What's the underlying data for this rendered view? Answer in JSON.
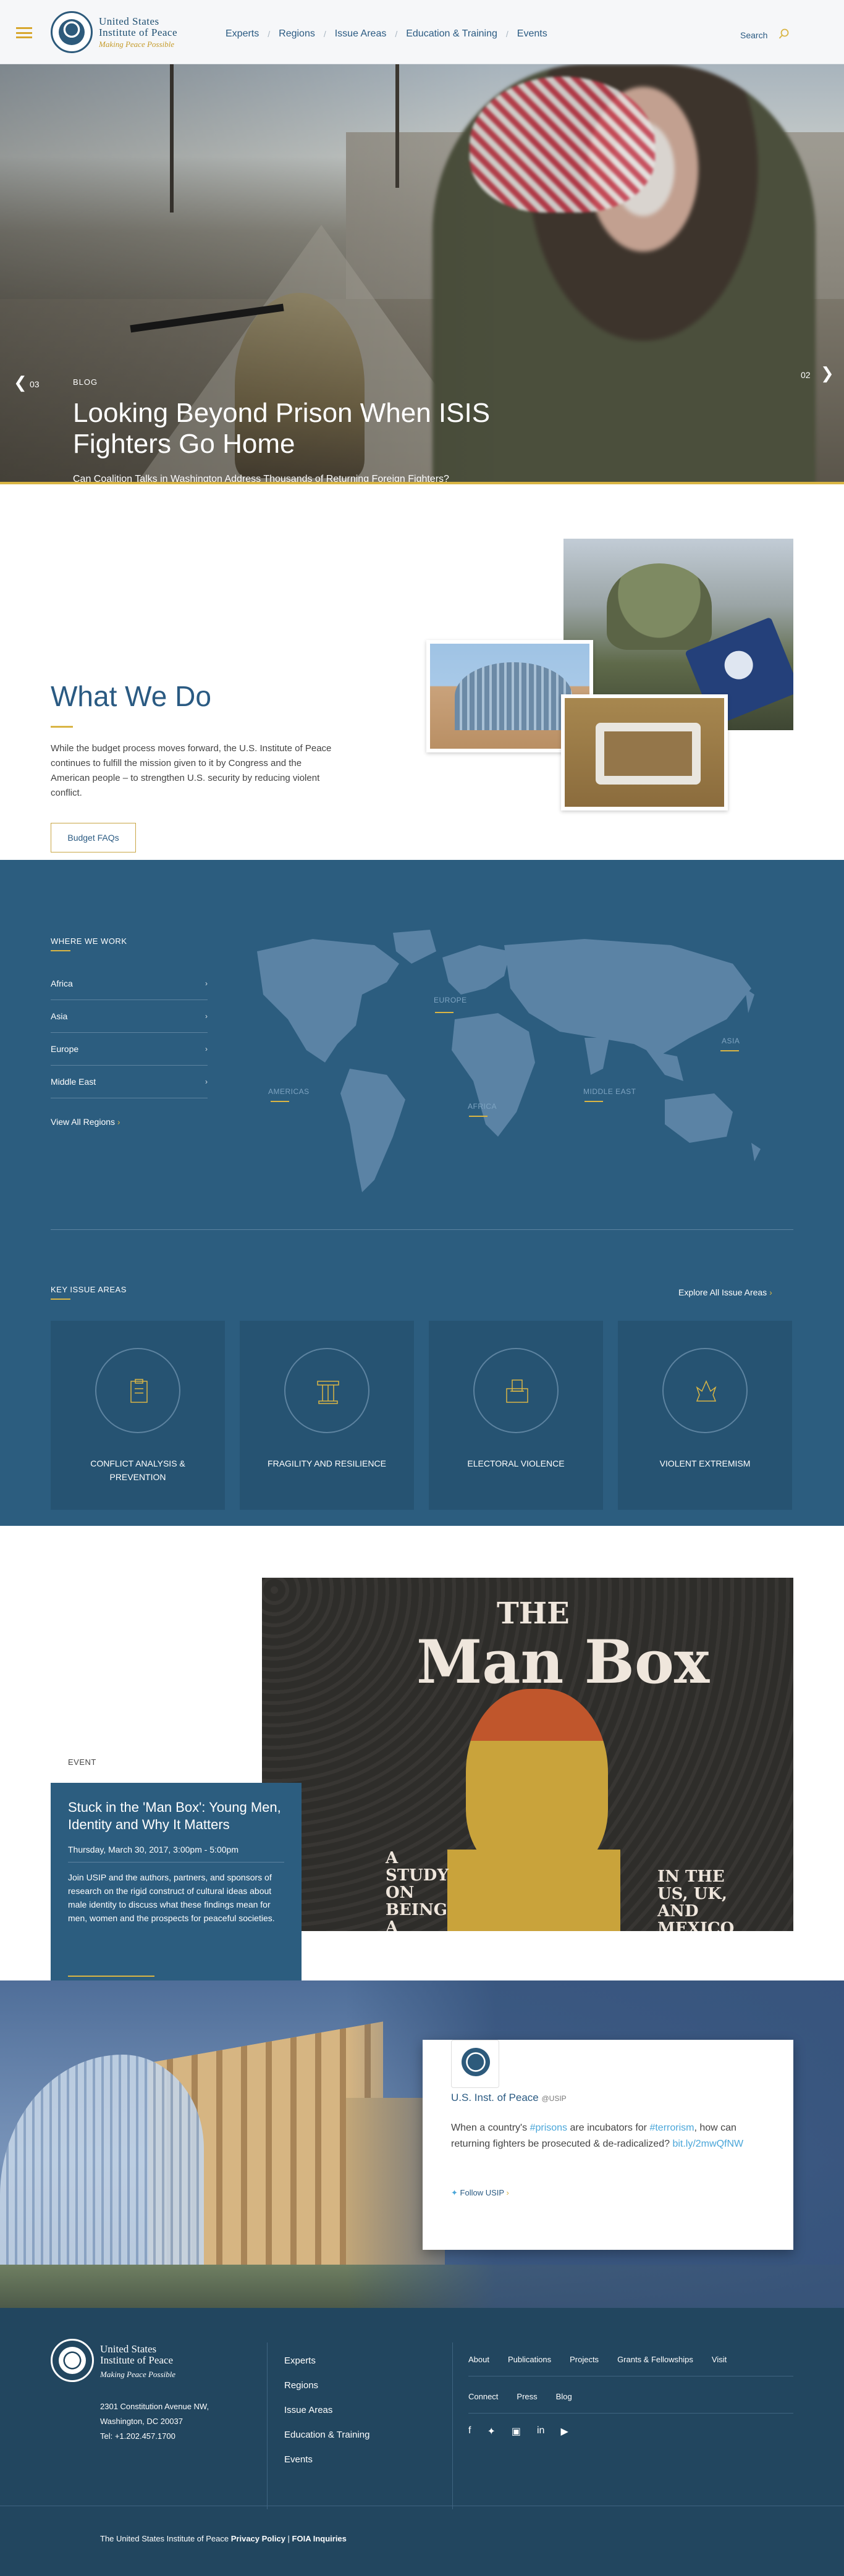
{
  "header": {
    "logo_title_line1": "United States",
    "logo_title_line2": "Institute of Peace",
    "logo_tagline": "Making Peace Possible",
    "nav": [
      "Experts",
      "Regions",
      "Issue Areas",
      "Education & Training",
      "Events"
    ],
    "search_label": "Search"
  },
  "hero": {
    "prev_number": "03",
    "next_number": "02",
    "kicker": "BLOG",
    "title": "Looking Beyond Prison When ISIS Fighters Go Home",
    "subtitle": "Can Coalition Talks in Washington Address Thousands of Returning Foreign Fighters?"
  },
  "what_we_do": {
    "title": "What We Do",
    "text": "While the budget process moves forward, the U.S. Institute of Peace continues to fulfill the mission given to it by Congress and the American people – to strengthen U.S. security by reducing violent conflict.",
    "button": "Budget FAQs"
  },
  "where_we_work": {
    "label": "WHERE WE WORK",
    "regions": [
      "Africa",
      "Asia",
      "Europe",
      "Middle East"
    ],
    "view_all": "View All Regions",
    "map_labels": {
      "europe": "EUROPE",
      "asia": "ASIA",
      "americas": "AMERICAS",
      "africa": "AFRICA",
      "middle_east": "MIDDLE EAST"
    }
  },
  "key_issue_areas": {
    "label": "KEY ISSUE AREAS",
    "explore": "Explore All Issue Areas",
    "items": [
      {
        "name": "CONFLICT ANALYSIS & PREVENTION",
        "icon": "clipboard-icon"
      },
      {
        "name": "FRAGILITY AND RESILIENCE",
        "icon": "column-icon"
      },
      {
        "name": "ELECTORAL VIOLENCE",
        "icon": "ballot-box-icon"
      },
      {
        "name": "VIOLENT EXTREMISM",
        "icon": "flame-icon"
      }
    ]
  },
  "event": {
    "kicker": "EVENT",
    "title": "Stuck in the 'Man Box': Young Men, Identity and Why It Matters",
    "date": "Thursday, March 30, 2017, 3:00pm - 5:00pm",
    "description": "Join USIP and the authors, partners, and sponsors of research on the rigid construct of cultural ideas about male identity to discuss what these findings mean for men, women and the prospects for peaceful societies.",
    "art": {
      "title_top": "THE",
      "title_main": "Man Box",
      "left_text": "A STUDY ON BEING A YOUNG MAN",
      "right_text": "IN THE US, UK, AND MEXICO"
    }
  },
  "tweet": {
    "name": "U.S. Inst. of Peace",
    "handle": "@USIP",
    "text_before": "When a country's ",
    "hashtag1": "#prisons",
    "text_middle": " are incubators for ",
    "hashtag2": "#terrorism",
    "text_after": ", how can returning fighters be prosecuted & de-radicalized? ",
    "link": "bit.ly/2mwQfNW",
    "follow": "Follow USIP"
  },
  "footer": {
    "title_line1": "United States",
    "title_line2": "Institute of Peace",
    "tagline": "Making Peace Possible",
    "address1": "2301 Constitution Avenue NW,",
    "address2": "Washington, DC 20037",
    "phone": "Tel: +1.202.457.1700",
    "nav": [
      "Experts",
      "Regions",
      "Issue Areas",
      "Education & Training",
      "Events"
    ],
    "links_row1": [
      "About",
      "Publications",
      "Projects",
      "Grants & Fellowships",
      "Visit"
    ],
    "links_row2": [
      "Connect",
      "Press",
      "Blog"
    ],
    "social": [
      "facebook-icon",
      "twitter-icon",
      "instagram-icon",
      "linkedin-icon",
      "youtube-icon"
    ],
    "legal_text": "The United States Institute of Peace",
    "privacy": "Privacy Policy",
    "foia": "FOIA Inquiries"
  },
  "colors": {
    "accent": "#d9b544",
    "brand_blue": "#2c5d7f",
    "footer": "#22465f"
  }
}
